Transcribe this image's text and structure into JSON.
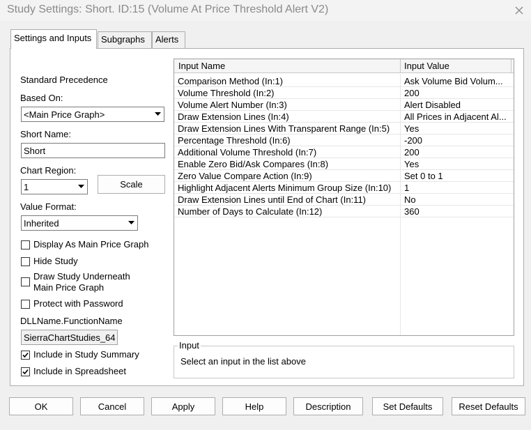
{
  "window": {
    "title": "Study Settings: Short. ID:15 (Volume At Price Threshold Alert V2)",
    "close_glyph": "✕"
  },
  "tabs": [
    {
      "label": "Settings and Inputs",
      "active": true
    },
    {
      "label": "Subgraphs",
      "active": false
    },
    {
      "label": "Alerts",
      "active": false
    }
  ],
  "left": {
    "standard_precedence_label": "Standard Precedence",
    "based_on_label": "Based On:",
    "based_on_value": "<Main Price Graph>",
    "short_name_label": "Short Name:",
    "short_name_value": "Short",
    "chart_region_label": "Chart Region:",
    "chart_region_value": "1",
    "scale_button": "Scale",
    "value_format_label": "Value Format:",
    "value_format_value": "Inherited",
    "checkboxes": [
      {
        "label": "Display As Main Price Graph",
        "checked": false
      },
      {
        "label": "Hide Study",
        "checked": false
      },
      {
        "label": "Draw Study Underneath Main Price Graph",
        "line1": "Draw Study Underneath",
        "line2": "Main Price Graph",
        "checked": false
      },
      {
        "label": "Protect with Password",
        "checked": false
      }
    ],
    "dll_label": "DLLName.FunctionName",
    "dll_value": "SierraChartStudies_64",
    "bottom_checkboxes": [
      {
        "label": "Include in Study Summary",
        "checked": true
      },
      {
        "label": "Include in Spreadsheet",
        "checked": true
      }
    ]
  },
  "inputs_table": {
    "columns": [
      "Input Name",
      "Input Value"
    ],
    "rows": [
      {
        "name": "Comparison Method  (In:1)",
        "value": "Ask Volume Bid Volum..."
      },
      {
        "name": "Volume Threshold  (In:2)",
        "value": "200"
      },
      {
        "name": "Volume Alert Number  (In:3)",
        "value": "Alert Disabled"
      },
      {
        "name": "Draw Extension Lines  (In:4)",
        "value": "All Prices in Adjacent Al..."
      },
      {
        "name": "Draw Extension Lines With Transparent Range  (In:5)",
        "value": "Yes"
      },
      {
        "name": "Percentage Threshold  (In:6)",
        "value": "-200"
      },
      {
        "name": "Additional Volume Threshold  (In:7)",
        "value": "200"
      },
      {
        "name": "Enable Zero Bid/Ask Compares  (In:8)",
        "value": "Yes"
      },
      {
        "name": "Zero Value Compare Action  (In:9)",
        "value": "Set 0 to 1"
      },
      {
        "name": "Highlight Adjacent Alerts Minimum Group Size  (In:10)",
        "value": "1"
      },
      {
        "name": "Draw Extension Lines until End of Chart  (In:11)",
        "value": "No"
      },
      {
        "name": "Number of Days to Calculate  (In:12)",
        "value": "360"
      }
    ]
  },
  "input_group": {
    "legend": "Input",
    "description": "Select an input in the list above"
  },
  "buttons": {
    "ok": "OK",
    "cancel": "Cancel",
    "apply": "Apply",
    "help": "Help",
    "description": "Description",
    "set_defaults": "Set Defaults",
    "reset_defaults": "Reset Defaults"
  }
}
